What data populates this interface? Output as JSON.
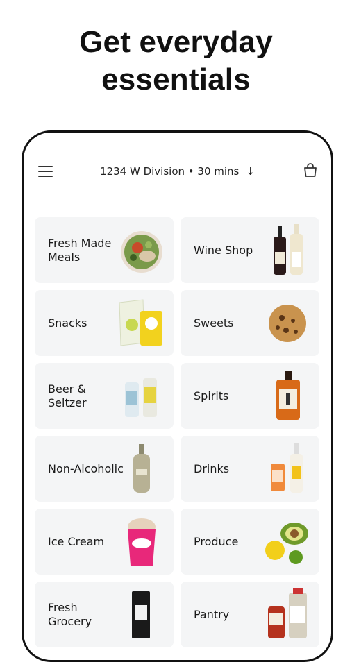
{
  "headline": {
    "line1": "Get everyday",
    "line2": "essentials"
  },
  "header": {
    "address": "1234 W Division • 30 mins",
    "arrow": "↓"
  },
  "categories": [
    {
      "label": "Fresh Made Meals",
      "icon": "salad-bowl-icon"
    },
    {
      "label": "Wine Shop",
      "icon": "wine-bottles-icon"
    },
    {
      "label": "Snacks",
      "icon": "snack-bags-icon"
    },
    {
      "label": "Sweets",
      "icon": "cookie-icon"
    },
    {
      "label": "Beer & Seltzer",
      "icon": "beer-cans-icon"
    },
    {
      "label": "Spirits",
      "icon": "whisky-bottle-icon"
    },
    {
      "label": "Non-Alcoholic",
      "icon": "nonalcoholic-bottle-icon"
    },
    {
      "label": "Drinks",
      "icon": "drink-bottles-icon"
    },
    {
      "label": "Ice Cream",
      "icon": "ice-cream-pint-icon"
    },
    {
      "label": "Produce",
      "icon": "avocado-lemon-icon"
    },
    {
      "label": "Fresh Grocery",
      "icon": "oat-milk-carton-icon"
    },
    {
      "label": "Pantry",
      "icon": "sauce-jars-icon"
    }
  ],
  "colors": {
    "tile_bg": "#f4f5f6",
    "text": "#111111"
  }
}
